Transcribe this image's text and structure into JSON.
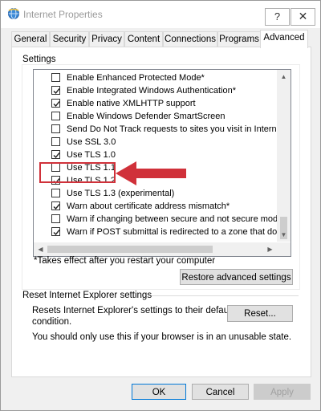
{
  "window": {
    "title": "Internet Properties",
    "help_glyph": "?",
    "close_glyph": "✕"
  },
  "tabs": [
    {
      "label": "General",
      "active": false
    },
    {
      "label": "Security",
      "active": false
    },
    {
      "label": "Privacy",
      "active": false
    },
    {
      "label": "Content",
      "active": false
    },
    {
      "label": "Connections",
      "active": false
    },
    {
      "label": "Programs",
      "active": false
    },
    {
      "label": "Advanced",
      "active": true
    }
  ],
  "settings": {
    "group_label": "Settings",
    "items": [
      {
        "label": "Enable Enhanced Protected Mode*",
        "checked": false
      },
      {
        "label": "Enable Integrated Windows Authentication*",
        "checked": true
      },
      {
        "label": "Enable native XMLHTTP support",
        "checked": true
      },
      {
        "label": "Enable Windows Defender SmartScreen",
        "checked": false
      },
      {
        "label": "Send Do Not Track requests to sites you visit in Internet E",
        "checked": false
      },
      {
        "label": "Use SSL 3.0",
        "checked": false
      },
      {
        "label": "Use TLS 1.0",
        "checked": true
      },
      {
        "label": "Use TLS 1.1",
        "checked": false
      },
      {
        "label": "Use TLS 1.2",
        "checked": true
      },
      {
        "label": "Use TLS 1.3 (experimental)",
        "checked": false
      },
      {
        "label": "Warn about certificate address mismatch*",
        "checked": true
      },
      {
        "label": "Warn if changing between secure and not secure mode",
        "checked": false
      },
      {
        "label": "Warn if POST submittal is redirected to a zone that does n",
        "checked": true
      }
    ],
    "scroll": {
      "up": "▲",
      "down": "▼",
      "left": "◀",
      "right": "▶"
    },
    "restart_note": "*Takes effect after you restart your computer",
    "restore_button": "Restore advanced settings"
  },
  "reset": {
    "group_label": "Reset Internet Explorer settings",
    "description_line1": "Resets Internet Explorer's settings to their default",
    "description_line2": "condition.",
    "button": "Reset...",
    "warning": "You should only use this if your browser is in an unusable state."
  },
  "footer": {
    "ok": "OK",
    "cancel": "Cancel",
    "apply": "Apply"
  },
  "colors": {
    "annotation_red": "#d0313a",
    "checkmark": "#222222"
  },
  "icons": {
    "title": "internet-globe-icon",
    "annotation": "red-arrow-pointer"
  }
}
